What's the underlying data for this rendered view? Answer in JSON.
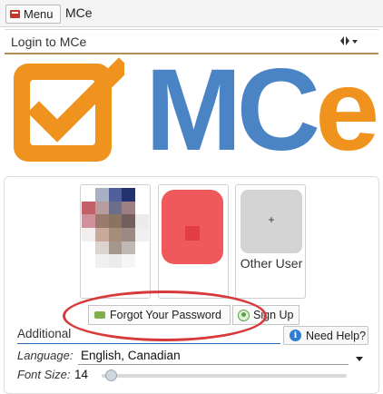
{
  "topbar": {
    "menu_label": "Menu",
    "app_title": "MCe"
  },
  "login": {
    "title": "Login to MCe"
  },
  "logo": {
    "text_mc": "MC",
    "text_e": "e",
    "colors": {
      "blue": "#4a84c5",
      "orange": "#f0931e"
    }
  },
  "users": [
    {
      "label": "",
      "type": "pixelated-avatar"
    },
    {
      "label": "",
      "type": "red-avatar"
    },
    {
      "label": "Other User",
      "plus": "+"
    }
  ],
  "actions": {
    "forgot_password": "Forgot Your Password",
    "sign_up": "Sign Up"
  },
  "additional": {
    "title": "Additional",
    "help": "Need Help?",
    "language_label": "Language:",
    "language_value": "English, Canadian",
    "font_size_label": "Font Size:",
    "font_size_value": "14"
  },
  "colors": {
    "header_underline": "#b48d59",
    "annotation_circle": "#d73a3a"
  }
}
